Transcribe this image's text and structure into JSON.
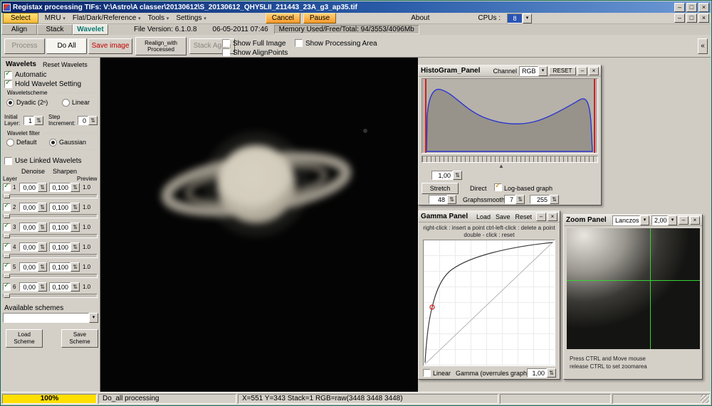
{
  "window": {
    "title": "Registax processing TIFs: V:\\Astro\\A classer\\20130612\\S_20130612_QHY5LII_211443_23A_g3_ap35.tif"
  },
  "icons": {
    "minimize": "–",
    "maximize": "□",
    "close": "×",
    "dropdown": "▾",
    "spinner": "⇅",
    "collapse": "«",
    "pointer": "▲",
    "check": "✓"
  },
  "menubar": {
    "select": "Select",
    "mru": "MRU",
    "flat_dark_ref": "Flat/Dark/Reference",
    "tools": "Tools",
    "settings": "Settings",
    "cancel": "Cancel",
    "pause": "Pause",
    "about": "About",
    "cpus_label": "CPUs :",
    "cpus_value": "8"
  },
  "tabs": {
    "align": "Align",
    "stack": "Stack",
    "wavelet": "Wavelet"
  },
  "infobar": {
    "file_version": "File Version: 6.1.0.8",
    "datetime": "06-05-2011 07:46",
    "memory": "Memory Used/Free/Total: 94/3553/4096Mb"
  },
  "toolbar": {
    "process": "Process",
    "do_all": "Do All",
    "save_image": "Save image",
    "realign_line1": "Realign_with",
    "realign_line2": "Processed",
    "stack_again": "Stack Again",
    "show_full_image": "Show Full Image",
    "show_alignpoints": "Show AlignPoints",
    "show_processing_area": "Show Processing Area"
  },
  "wavelets": {
    "title": "Wavelets",
    "reset": "Reset Wavelets",
    "automatic": "Automatic",
    "hold": "Hold Wavelet Setting",
    "scheme_group": "Waveletscheme",
    "dyadic": "Dyadic (2ⁿ)",
    "linear": "Linear",
    "initial_layer_l1": "Initial",
    "initial_layer_l2": "Layer:",
    "initial_value": "1",
    "step_l1": "Step",
    "step_l2": "Increment:",
    "step_value": "0",
    "filter_group": "Wavelet filter",
    "filter_default": "Default",
    "filter_gaussian": "Gaussian",
    "use_linked": "Use Linked Wavelets",
    "denoise_header": "Denoise",
    "sharpen_header": "Sharpen",
    "layer_header": "Layer",
    "preview_header": "Preview",
    "layers": [
      {
        "num": "1",
        "denoise": "0,00",
        "sharpen": "0,100",
        "preview": "1.0"
      },
      {
        "num": "2",
        "denoise": "0,00",
        "sharpen": "0,100",
        "preview": "1.0"
      },
      {
        "num": "3",
        "denoise": "0,00",
        "sharpen": "0,100",
        "preview": "1.0"
      },
      {
        "num": "4",
        "denoise": "0,00",
        "sharpen": "0,100",
        "preview": "1.0"
      },
      {
        "num": "5",
        "denoise": "0,00",
        "sharpen": "0,100",
        "preview": "1.0"
      },
      {
        "num": "6",
        "denoise": "0,00",
        "sharpen": "0,100",
        "preview": "1.0"
      }
    ],
    "available_schemes": "Available schemes",
    "load_l1": "Load",
    "load_l2": "Scheme",
    "save_l1": "Save",
    "save_l2": "Scheme"
  },
  "histogram": {
    "title": "HistoGram_Panel",
    "channel_label": "Channel",
    "channel_value": "RGB",
    "reset": "RESET",
    "gain_value": "1,00",
    "stretch": "Stretch",
    "direct": "Direct",
    "log_based": "Log-based graph",
    "low_value": "48",
    "smooth_label": "Graphssmooth",
    "smooth_value": "7",
    "high_value": "255"
  },
  "gamma": {
    "title": "Gamma Panel",
    "load": "Load",
    "save": "Save",
    "reset": "Reset",
    "help1": "right-click : insert a point   ctrl-left-click : delete a point",
    "help2": "double - click : reset",
    "linear": "Linear",
    "gamma_label": "Gamma (overrules graph)",
    "gamma_value": "1,00"
  },
  "zoom": {
    "title": "Zoom Panel",
    "filter_value": "Lanczos",
    "zoom_value": "2,00",
    "help1": "Press CTRL and Move mouse",
    "help2": "release CTRL to set zoomarea"
  },
  "statusbar": {
    "progress": "100%",
    "status": "Do_all processing",
    "coords": "X=551 Y=343 Stack=1 RGB=raw(3448 3448 3448)"
  }
}
